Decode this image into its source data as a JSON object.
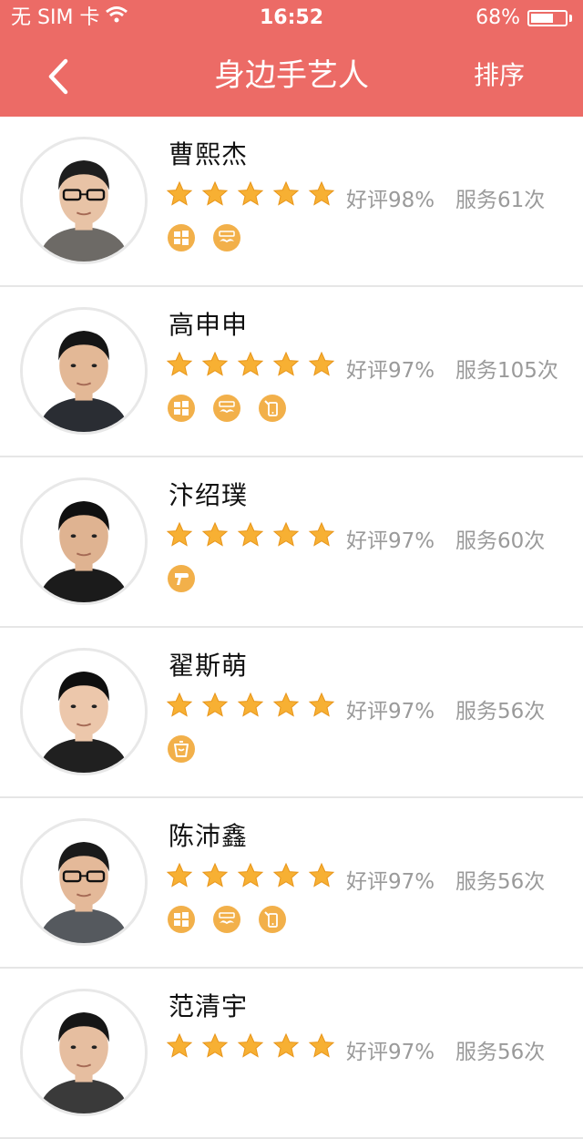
{
  "status_bar": {
    "carrier": "无 SIM 卡",
    "time": "16:52",
    "battery_text": "68%",
    "battery_level": 0.68
  },
  "nav": {
    "title": "身边手艺人",
    "sort_label": "排序"
  },
  "colors": {
    "header_bg": "#EC6B66",
    "star": "#F7B033",
    "skill_icon_bg": "#F2B04A",
    "secondary_text": "#9A9A9A"
  },
  "artisans": [
    {
      "name": "曹熙杰",
      "stars": 5,
      "rating": "好评98%",
      "served": "服务61次",
      "skills": [
        "windows-icon",
        "mustache-icon"
      ]
    },
    {
      "name": "高申申",
      "stars": 5,
      "rating": "好评97%",
      "served": "服务105次",
      "skills": [
        "windows-icon",
        "mustache-icon",
        "phone-repair-icon"
      ]
    },
    {
      "name": "汴绍璞",
      "stars": 5,
      "rating": "好评97%",
      "served": "服务60次",
      "skills": [
        "hairdryer-icon"
      ]
    },
    {
      "name": "翟斯萌",
      "stars": 5,
      "rating": "好评97%",
      "served": "服务56次",
      "skills": [
        "cup-icon"
      ]
    },
    {
      "name": "陈沛鑫",
      "stars": 5,
      "rating": "好评97%",
      "served": "服务56次",
      "skills": [
        "windows-icon",
        "mustache-icon",
        "phone-repair-icon"
      ]
    },
    {
      "name": "范清宇",
      "stars": 5,
      "rating": "好评97%",
      "served": "服务56次",
      "skills": []
    }
  ]
}
